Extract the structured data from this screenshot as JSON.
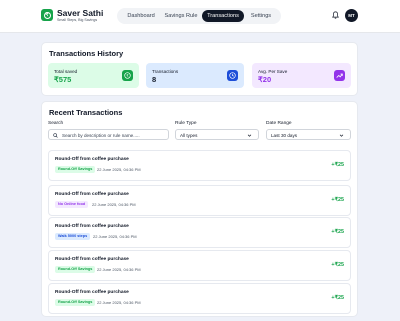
{
  "brand": {
    "name": "Saver Sathi",
    "tagline": "Small Steps, Big Savings",
    "logo_icon": "rupee-coin-icon",
    "logo_color": "#16a34a"
  },
  "nav": {
    "tabs": [
      {
        "label": "Dashboard",
        "active": false
      },
      {
        "label": "Savings Rule",
        "active": false
      },
      {
        "label": "Transactions",
        "active": true
      },
      {
        "label": "Settings",
        "active": false
      }
    ]
  },
  "user": {
    "initials": "MT"
  },
  "history": {
    "title": "Transactions History",
    "stats": [
      {
        "label": "Total saved",
        "value": "₹575",
        "icon": "rupee-icon",
        "bg": "#dcfce7",
        "color": "#16a34a"
      },
      {
        "label": "Transactions",
        "value": "8",
        "icon": "clock-icon",
        "bg": "#dbeafe",
        "color": "#1d4ed8"
      },
      {
        "label": "Avg. Per Save",
        "value": "₹20",
        "icon": "trend-up-icon",
        "bg": "#f3e8ff",
        "color": "#9333ea"
      }
    ]
  },
  "recent": {
    "title": "Recent Transactions",
    "filters": {
      "search_label": "Search",
      "search_placeholder": "Search by description or rule name.....",
      "rule_label": "Rule Type",
      "rule_value": "All types",
      "date_label": "Date Range",
      "date_value": "Last 30 days"
    },
    "rows": [
      {
        "title": "Round-Off from coffee purchase",
        "tag": "Round-Off Savings",
        "tag_bg": "#dcfce7",
        "tag_color": "#16a34a",
        "date": "22 June 2025, 04:36 PM",
        "amount": "+₹25"
      },
      {
        "title": "Round-Off from coffee purchase",
        "tag": "No Online food",
        "tag_bg": "#f3e8ff",
        "tag_color": "#9333ea",
        "date": "22 June 2025, 04:36 PM",
        "amount": "+₹25"
      },
      {
        "title": "Round-Off from coffee purchase",
        "tag": "Walk 5000 steps",
        "tag_bg": "#dbeafe",
        "tag_color": "#1d4ed8",
        "date": "22 June 2025, 04:36 PM",
        "amount": "+₹25"
      },
      {
        "title": "Round-Off from coffee purchase",
        "tag": "Round-Off Savings",
        "tag_bg": "#dcfce7",
        "tag_color": "#16a34a",
        "date": "22 June 2025, 04:36 PM",
        "amount": "+₹25"
      },
      {
        "title": "Round-Off from coffee purchase",
        "tag": "Round-Off Savings",
        "tag_bg": "#dcfce7",
        "tag_color": "#16a34a",
        "date": "22 June 2025, 04:36 PM",
        "amount": "+₹25"
      }
    ]
  }
}
